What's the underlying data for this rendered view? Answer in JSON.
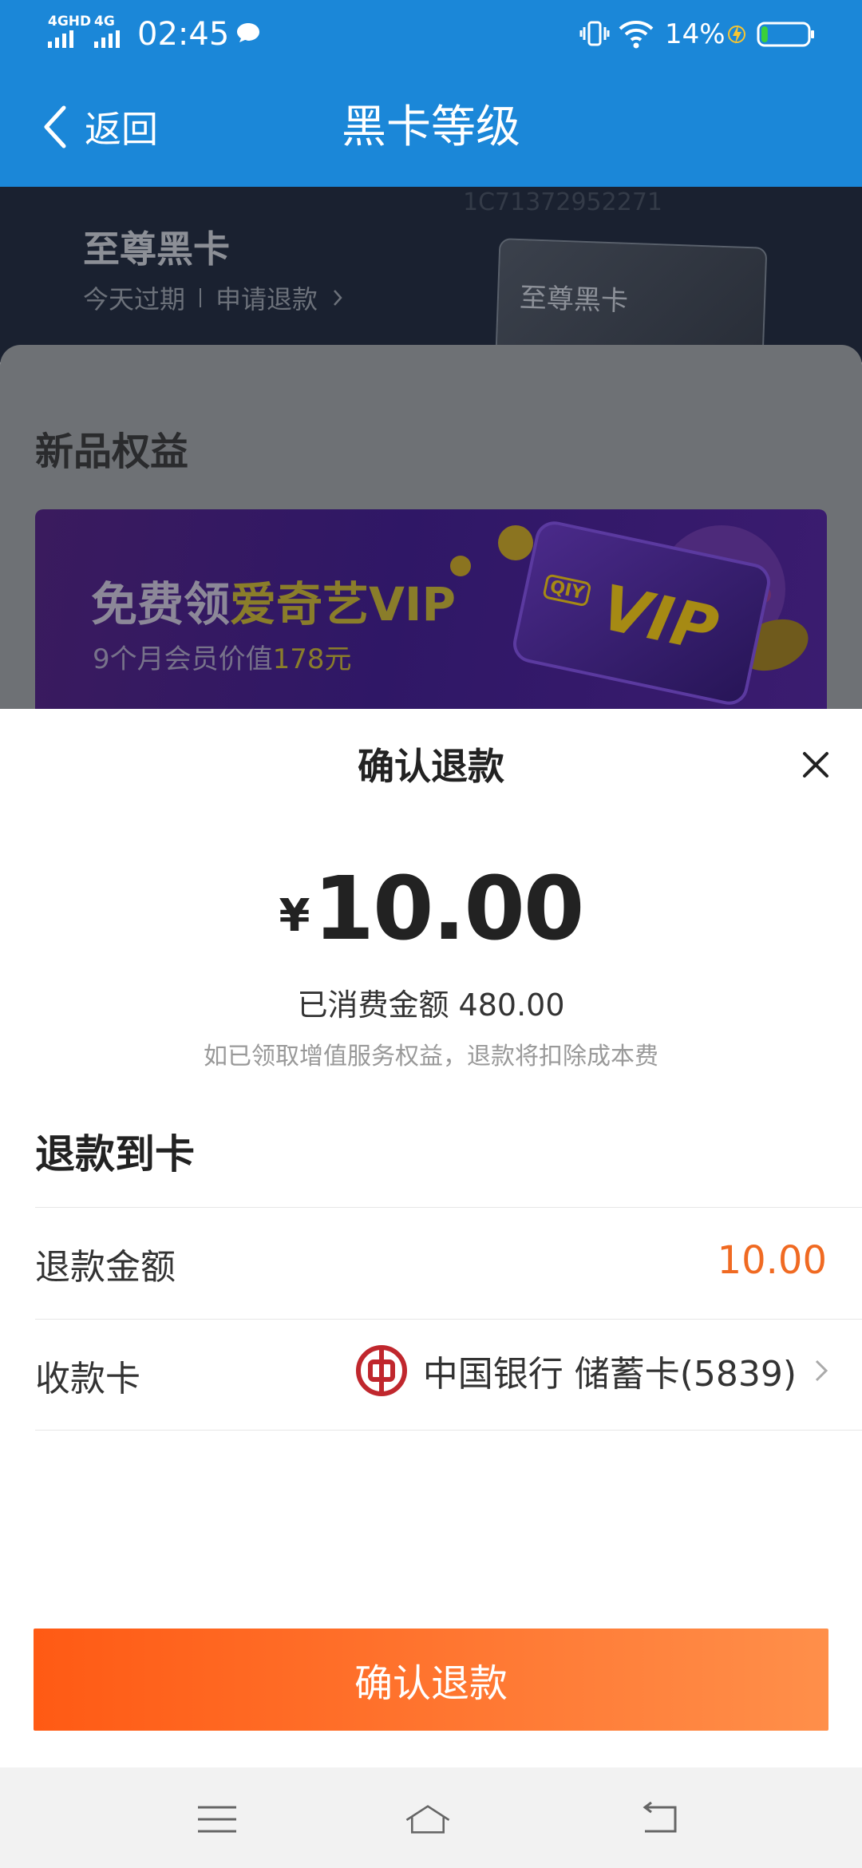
{
  "status_bar": {
    "sim1": "4GHD",
    "sim2": "4G",
    "time": "02:45",
    "battery_percent": "14%",
    "battery_level": 0.14,
    "icons": [
      "chat-bubble-icon",
      "vibrate-icon",
      "wifi-icon",
      "charging-bolt-icon",
      "battery-icon"
    ]
  },
  "nav": {
    "back_label": "返回",
    "title": "黑卡等级"
  },
  "background_page": {
    "card_title": "至尊黑卡",
    "expiry": "今天过期",
    "refund_link": "申请退款",
    "card_face_label": "至尊黑卡",
    "card_number": "1C71372952271",
    "section_heading": "新品权益",
    "banner": {
      "line1_prefix": "免费领",
      "line1_highlight": "爱奇艺VIP",
      "line2_prefix": "9个月会员价值",
      "line2_highlight": "178元",
      "badge_small": "QIY",
      "badge_large": "VIP"
    }
  },
  "sheet": {
    "title": "确认退款",
    "currency": "¥",
    "amount": "10.00",
    "consumed": "已消费金额 480.00",
    "notice": "如已领取增值服务权益，退款将扣除成本费",
    "section_title": "退款到卡",
    "refund_amount_label": "退款金额",
    "refund_amount_value": "10.00",
    "receive_card_label": "收款卡",
    "receive_card_value": "中国银行 储蓄卡(5839)",
    "confirm_button": "确认退款",
    "colors": {
      "accent": "#f06a22",
      "button_start": "#ff5a14",
      "button_end": "#ff8f4a",
      "bank_logo": "#c0272d"
    }
  },
  "system_nav": {
    "icons": [
      "menu-icon",
      "home-icon",
      "back-icon"
    ]
  }
}
